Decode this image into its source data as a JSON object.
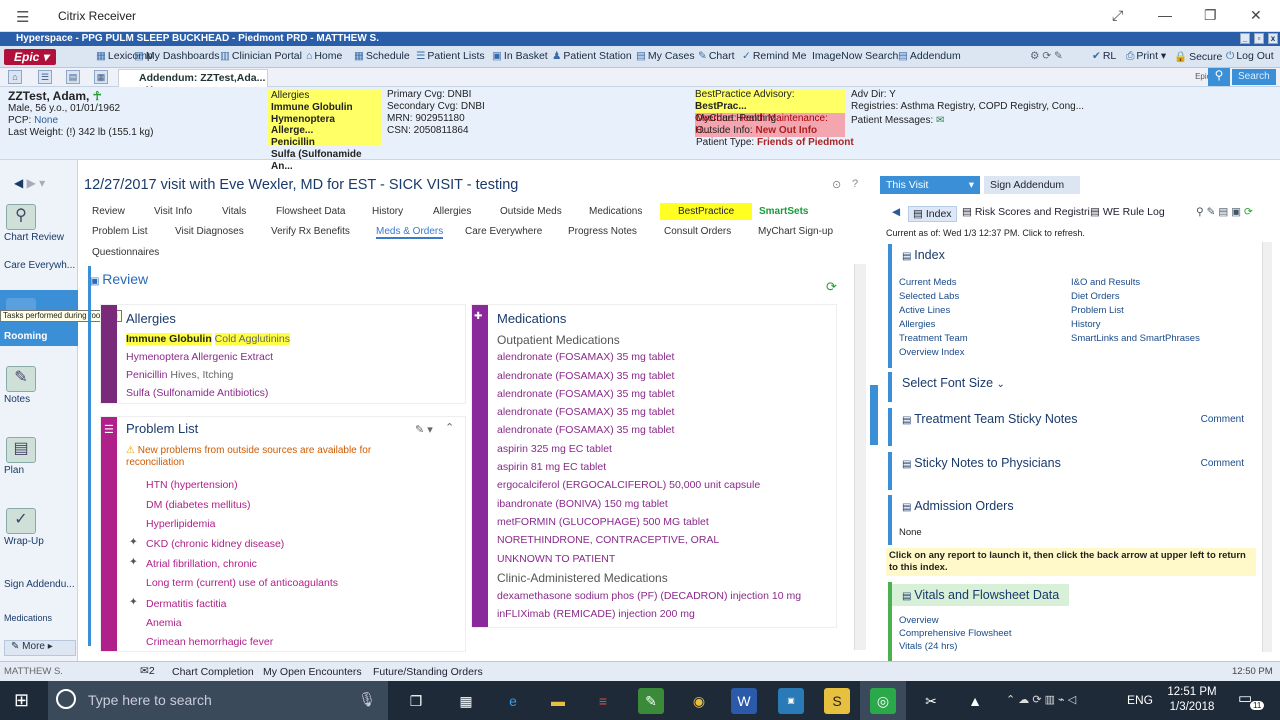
{
  "citrix": {
    "title": "Citrix Receiver"
  },
  "hyperspace": {
    "title": "Hyperspace - PPG PULM SLEEP BUCKHEAD - Piedmont PRD - MATTHEW S."
  },
  "toolbar": {
    "epic": "Epic",
    "items": [
      "Lexicomp",
      "My Dashboards",
      "Clinician Portal",
      "Home",
      "Schedule",
      "Patient Lists",
      "In Basket",
      "Patient Station",
      "My Cases",
      "Chart",
      "Remind Me",
      "ImageNow Search",
      "Addendum",
      "RL",
      "Print",
      "Secure",
      "Log Out"
    ]
  },
  "tabs": {
    "patient_tab": "Addendum: ZZTest,Ada...",
    "epicare": "EpicCare",
    "search": "Search"
  },
  "patient": {
    "name": "ZZTest, Adam,",
    "demo": "Male, 56 y.o., 01/01/1962",
    "pcp_label": "PCP:",
    "pcp": "None",
    "weight": "Last Weight: (!) 342 lb (155.1 kg)",
    "allergies_label": "Allergies",
    "allergies": [
      "Immune Globulin",
      "Hymenoptera Allerge...",
      "Penicillin",
      "Sulfa (Sulfonamide An..."
    ],
    "primary_cvg": "Primary Cvg: DNBI",
    "secondary_cvg": "Secondary Cvg: DNBI",
    "mrn": "MRN: 902951180",
    "csn": "CSN: 2050811864",
    "bp_advisory_label": "BestPractice Advisory:",
    "bp_advisory": "BestPrac...",
    "overdue": "Overdue Health Maintenance: H...",
    "mychart_label": "MyChart:",
    "mychart": "Pending",
    "outside_label": "Outside Info:",
    "outside": "New Out Info",
    "ptype_label": "Patient Type:",
    "ptype": "Friends of Piedmont",
    "adv_dir": "Adv Dir: Y",
    "registries": "Registries: Asthma Registry, COPD Registry, Cong...",
    "messages": "Patient Messages:"
  },
  "sidebar": {
    "items": [
      "Chart Review",
      "Care Everywh...",
      "Rooming",
      "Notes",
      "Plan",
      "Wrap-Up",
      "Sign Addendu...",
      "Medications"
    ],
    "tooltip": "Tasks performed during rooming",
    "more": "More"
  },
  "visit": {
    "title": "12/27/2017 visit with Eve Wexler, MD for EST - SICK VISIT - testing",
    "tabs_row1": [
      "Review",
      "Visit Info",
      "Vitals",
      "Flowsheet Data",
      "History",
      "Allergies",
      "Outside Meds",
      "Medications",
      "BestPractice",
      "SmartSets"
    ],
    "tabs_row2": [
      "Problem List",
      "Visit Diagnoses",
      "Verify Rx Benefits",
      "Meds & Orders",
      "Care Everywhere",
      "Progress Notes",
      "Consult Orders",
      "MyChart Sign-up"
    ],
    "tabs_row3": [
      "Questionnaires"
    ]
  },
  "review": {
    "header": "Review",
    "allergies": {
      "title": "Allergies",
      "items": [
        {
          "name": "Immune Globulin",
          "reaction": "Cold Agglutinins"
        },
        {
          "name": "Hymenoptera Allergenic Extract",
          "reaction": ""
        },
        {
          "name": "Penicillin",
          "reaction": "Hives, Itching"
        },
        {
          "name": "Sulfa (Sulfonamide Antibiotics)",
          "reaction": ""
        }
      ]
    },
    "problems": {
      "title": "Problem List",
      "warning": "New problems from outside sources are available for reconciliation",
      "items": [
        "HTN (hypertension)",
        "DM (diabetes mellitus)",
        "Hyperlipidemia",
        "CKD (chronic kidney disease)",
        "Atrial fibrillation, chronic",
        "Long term (current) use of anticoagulants",
        "Dermatitis factitia",
        "Anemia",
        "Crimean hemorrhagic fever"
      ]
    },
    "meds": {
      "title": "Medications",
      "outpatient_title": "Outpatient Medications",
      "outpatient": [
        "alendronate (FOSAMAX) 35 mg tablet",
        "alendronate (FOSAMAX) 35 mg tablet",
        "alendronate (FOSAMAX) 35 mg tablet",
        "alendronate (FOSAMAX) 35 mg tablet",
        "alendronate (FOSAMAX) 35 mg tablet",
        "aspirin 325 mg EC tablet",
        "aspirin 81 mg EC tablet",
        "ergocalciferol (ERGOCALCIFEROL) 50,000 unit capsule",
        "ibandronate (BONIVA) 150 mg tablet",
        "metFORMIN (GLUCOPHAGE) 500 MG tablet",
        "NORETHINDRONE, CONTRACEPTIVE, ORAL",
        "UNKNOWN TO PATIENT"
      ],
      "clinic_title": "Clinic-Administered Medications",
      "clinic": [
        "dexamethasone sodium phos (PF) (DECADRON) injection 10 mg",
        "inFLIXimab (REMICADE) injection 200 mg"
      ]
    }
  },
  "right": {
    "tab1": "This Visit",
    "tab2": "Sign Addendum",
    "tool_index": "Index",
    "tool_risk": "Risk Scores and Registri",
    "tool_rule": "WE Rule Log",
    "current": "Current as of: Wed 1/3 12:37 PM. Click to refresh.",
    "index_title": "Index",
    "index_links_left": [
      "Current Meds",
      "Selected Labs",
      "Active Lines",
      "Allergies",
      "Treatment Team",
      "Overview Index"
    ],
    "index_links_right": [
      "I&O and Results",
      "Diet Orders",
      "Problem List",
      "History",
      "SmartLinks and SmartPhrases"
    ],
    "font_size": "Select Font Size",
    "treatment": "Treatment Team Sticky Notes",
    "sticky": "Sticky Notes to Physicians",
    "comment": "Comment",
    "admission": "Admission Orders",
    "admission_val": "None",
    "warn": "Click on any report to launch it, then click the back arrow at upper left to return to this index.",
    "vitals": "Vitals and Flowsheet Data",
    "vitals_links": [
      "Overview",
      "Comprehensive Flowsheet",
      "Vitals (24 hrs)"
    ]
  },
  "status": {
    "user": "MATTHEW S.",
    "count": "2",
    "items": [
      "Chart Completion",
      "My Open Encounters",
      "Future/Standing Orders"
    ],
    "time": "12:50 PM"
  },
  "taskbar": {
    "search": "Type here to search",
    "lang": "ENG",
    "time": "12:51 PM",
    "date": "1/3/2018",
    "notif": "11"
  }
}
